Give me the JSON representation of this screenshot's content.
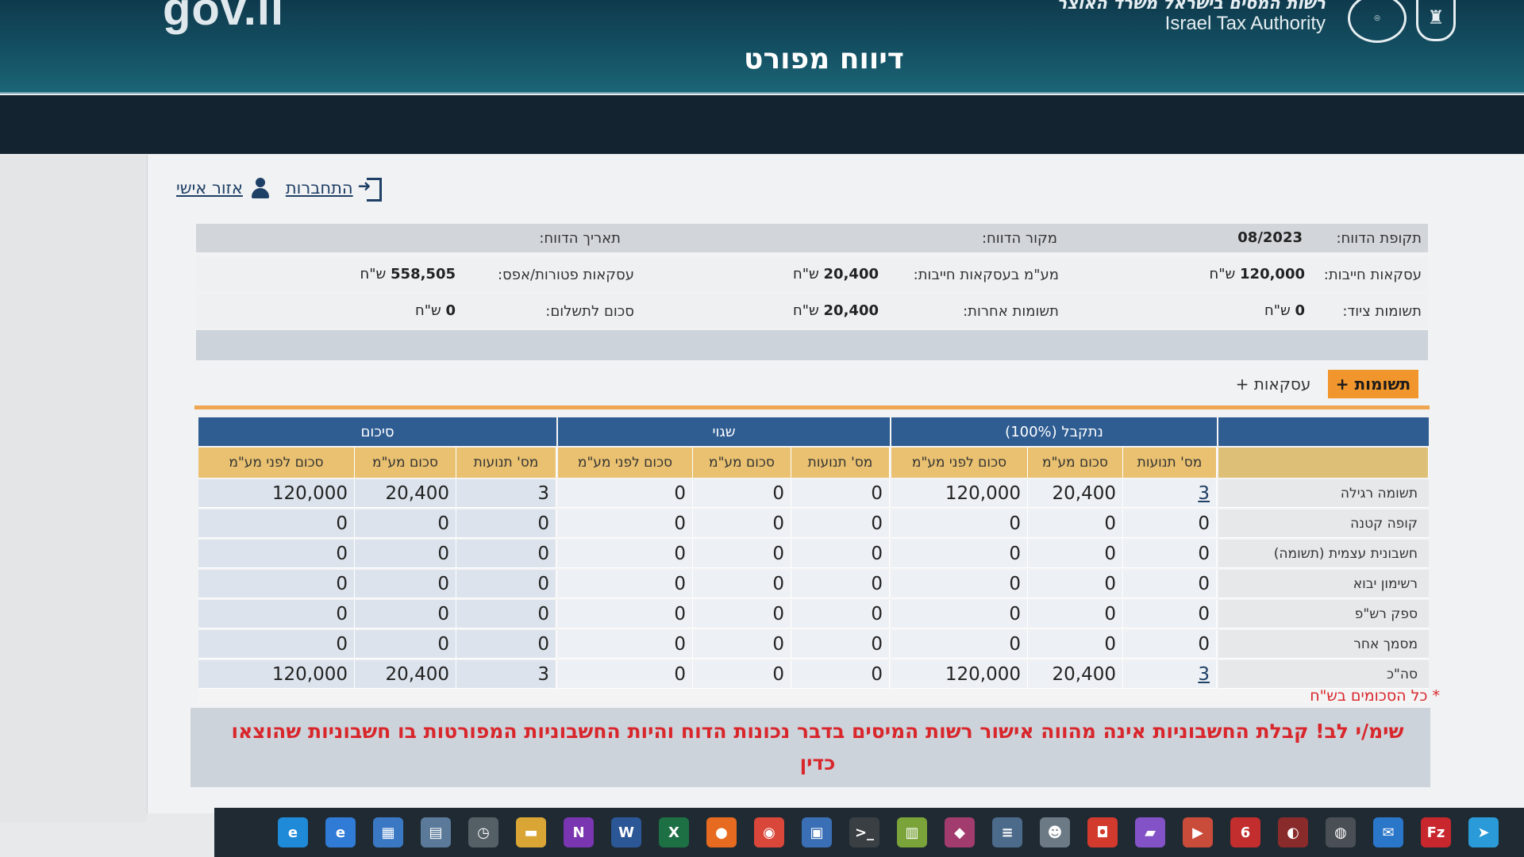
{
  "header": {
    "gov_logo": "gov.il",
    "authority_he": "רשות המסים בישראל משרד האוצר",
    "authority_en": "Israel Tax Authority",
    "page_title": "דיווח מפורט"
  },
  "user_links": {
    "personal_area": "אזור אישי",
    "login": "התחברות"
  },
  "info": {
    "report_period_label": "תקופת הדווח:",
    "report_period_value": "08/2023",
    "report_source_label": "מקור הדווח:",
    "report_source_value": "",
    "report_date_label": "תאריך הדווח:",
    "report_date_value": "",
    "taxable_tx_label": "עסקאות חייבות:",
    "taxable_tx_value": "120,000",
    "vat_on_taxable_label": "מע\"מ בעסקאות חייבות:",
    "vat_on_taxable_value": "20,400",
    "exempt_tx_label": "עסקאות פטורות/אפס:",
    "exempt_tx_value": "558,505",
    "equipment_inputs_label": "תשומות ציוד:",
    "equipment_inputs_value": "0",
    "other_inputs_label": "תשומות אחרות:",
    "other_inputs_value": "20,400",
    "amount_to_pay_label": "סכום לתשלום:",
    "amount_to_pay_value": "0",
    "currency": "ש\"ח"
  },
  "tabs": {
    "inputs": "תשומות +",
    "transactions": "עסקאות +"
  },
  "table": {
    "groups": {
      "accepted": "נתקבל (100%)",
      "error": "שגוי",
      "summary": "סיכום"
    },
    "subheaders": {
      "count": "מס' תנועות",
      "vat_amount": "סכום מע\"מ",
      "pre_vat": "סכום לפני מע\"מ"
    },
    "rows": [
      {
        "label": "תשומה רגילה",
        "acc_count": "3",
        "acc_vat": "20,400",
        "acc_pre": "120,000",
        "err_count": "0",
        "err_vat": "0",
        "err_pre": "0",
        "sum_count": "3",
        "sum_vat": "20,400",
        "sum_pre": "120,000"
      },
      {
        "label": "קופה קטנה",
        "acc_count": "0",
        "acc_vat": "0",
        "acc_pre": "0",
        "err_count": "0",
        "err_vat": "0",
        "err_pre": "0",
        "sum_count": "0",
        "sum_vat": "0",
        "sum_pre": "0"
      },
      {
        "label": "חשבונית עצמית (תשומה)",
        "acc_count": "0",
        "acc_vat": "0",
        "acc_pre": "0",
        "err_count": "0",
        "err_vat": "0",
        "err_pre": "0",
        "sum_count": "0",
        "sum_vat": "0",
        "sum_pre": "0"
      },
      {
        "label": "רשימון יבוא",
        "acc_count": "0",
        "acc_vat": "0",
        "acc_pre": "0",
        "err_count": "0",
        "err_vat": "0",
        "err_pre": "0",
        "sum_count": "0",
        "sum_vat": "0",
        "sum_pre": "0"
      },
      {
        "label": "ספק רש\"פ",
        "acc_count": "0",
        "acc_vat": "0",
        "acc_pre": "0",
        "err_count": "0",
        "err_vat": "0",
        "err_pre": "0",
        "sum_count": "0",
        "sum_vat": "0",
        "sum_pre": "0"
      },
      {
        "label": "מסמך אחר",
        "acc_count": "0",
        "acc_vat": "0",
        "acc_pre": "0",
        "err_count": "0",
        "err_vat": "0",
        "err_pre": "0",
        "sum_count": "0",
        "sum_vat": "0",
        "sum_pre": "0"
      },
      {
        "label": "סה\"כ",
        "acc_count": "3",
        "acc_vat": "20,400",
        "acc_pre": "120,000",
        "err_count": "0",
        "err_vat": "0",
        "err_pre": "0",
        "sum_count": "3",
        "sum_vat": "20,400",
        "sum_pre": "120,000"
      }
    ]
  },
  "note": "* כל הסכומים בש\"ח",
  "warning": "שימ/י לב! קבלת החשבוניות אינה מהווה אישור רשות המיסים בדבר נכונות הדוח והיות החשבוניות המפורטות בו חשבוניות שהוצאו כדין",
  "taskbar": {
    "icons": [
      {
        "name": "edge-icon",
        "color": "#1f8ad8",
        "glyph": "e"
      },
      {
        "name": "ie-icon",
        "color": "#2f7bd6",
        "glyph": "e"
      },
      {
        "name": "store-icon",
        "color": "#3b78c4",
        "glyph": "▦"
      },
      {
        "name": "files-icon",
        "color": "#5b7a99",
        "glyph": "▤"
      },
      {
        "name": "clock-icon",
        "color": "#555f66",
        "glyph": "◷"
      },
      {
        "name": "folder-icon",
        "color": "#d9a534",
        "glyph": "▬"
      },
      {
        "name": "onenote-icon",
        "color": "#7a36b0",
        "glyph": "N"
      },
      {
        "name": "word-icon",
        "color": "#2b5797",
        "glyph": "W"
      },
      {
        "name": "excel-icon",
        "color": "#1d7044",
        "glyph": "X"
      },
      {
        "name": "firefox-icon",
        "color": "#e66a1f",
        "glyph": "●"
      },
      {
        "name": "chrome-icon",
        "color": "#d9473b",
        "glyph": "◉"
      },
      {
        "name": "calendar-icon",
        "color": "#3b6fb5",
        "glyph": "▣"
      },
      {
        "name": "terminal-icon",
        "color": "#3a3f44",
        "glyph": ">_"
      },
      {
        "name": "notepad-icon",
        "color": "#7aa33a",
        "glyph": "▥"
      },
      {
        "name": "app-icon",
        "color": "#a23b6e",
        "glyph": "◆"
      },
      {
        "name": "database-icon",
        "color": "#4c6a8a",
        "glyph": "≡"
      },
      {
        "name": "discord-icon",
        "color": "#6c7a86",
        "glyph": "☻"
      },
      {
        "name": "anydesk-icon",
        "color": "#d23a2e",
        "glyph": "◘"
      },
      {
        "name": "vs-icon",
        "color": "#8452c7",
        "glyph": "▰"
      },
      {
        "name": "media-icon",
        "color": "#c94c3a",
        "glyph": "▶"
      },
      {
        "name": "pdf-icon",
        "color": "#c22d2d",
        "glyph": "6"
      },
      {
        "name": "record-icon",
        "color": "#8a2b2b",
        "glyph": "◐"
      },
      {
        "name": "obs-icon",
        "color": "#4a4f55",
        "glyph": "◍"
      },
      {
        "name": "mail-icon",
        "color": "#2a76c9",
        "glyph": "✉"
      },
      {
        "name": "filezilla-icon",
        "color": "#c8272d",
        "glyph": "Fz"
      },
      {
        "name": "telegram-icon",
        "color": "#2a9bd8",
        "glyph": "➤"
      }
    ]
  }
}
